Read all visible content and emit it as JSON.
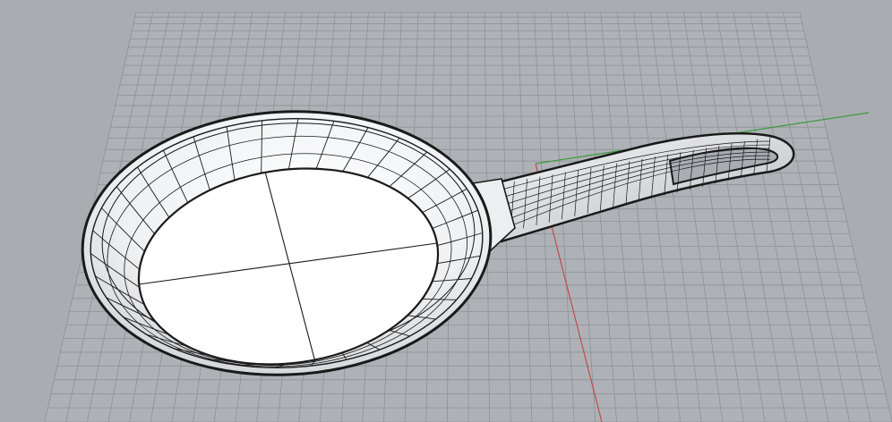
{
  "viewport": {
    "background": "#a9adb2",
    "grid_color": "#8e9297",
    "x_axis_color": "#c24a4a",
    "y_axis_color": "#3a9a3a",
    "wire_color": "#1a1a1a",
    "surface_light": "#ffffff",
    "surface_shade": "#c9ccd0"
  },
  "model": {
    "object": "frying-pan",
    "display_mode": "shaded-with-isocurves"
  }
}
